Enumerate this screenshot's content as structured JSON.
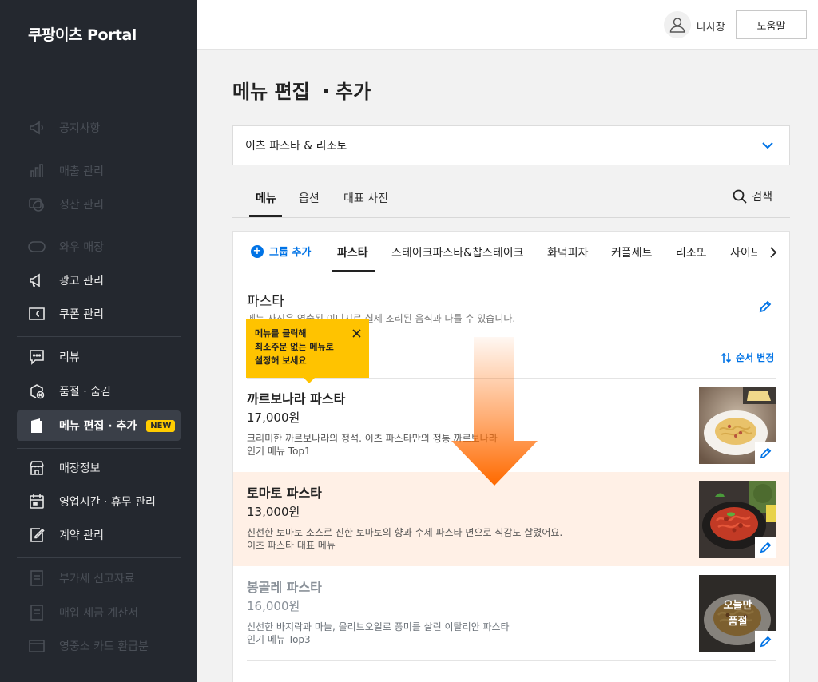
{
  "brand": "쿠팡이츠 Portal",
  "sidebar": {
    "items": [
      {
        "label": "공지사항",
        "icon": "megaphone-icon"
      },
      {
        "label": "매출 관리",
        "icon": "bar-chart-icon"
      },
      {
        "label": "정산 관리",
        "icon": "won-coin-icon"
      },
      {
        "label": "와우 매장",
        "icon": "wow-icon"
      },
      {
        "label": "광고 관리",
        "icon": "megaphone-icon"
      },
      {
        "label": "쿠폰 관리",
        "icon": "coupon-icon"
      },
      {
        "label": "리뷰",
        "icon": "chat-icon"
      },
      {
        "label": "품절 · 숨김",
        "icon": "soldout-box-icon"
      },
      {
        "label": "메뉴 편집 · 추가",
        "icon": "menu-book-icon",
        "badge": "NEW"
      },
      {
        "label": "매장정보",
        "icon": "store-icon"
      },
      {
        "label": "영업시간 · 휴무 관리",
        "icon": "calendar-icon"
      },
      {
        "label": "계약 관리",
        "icon": "contract-icon"
      },
      {
        "label": "부가세 신고자료",
        "icon": "vat-doc-icon"
      },
      {
        "label": "매입 세금 계산서",
        "icon": "tax-doc-icon"
      },
      {
        "label": "영중소 카드 환급분",
        "icon": "card-icon"
      }
    ]
  },
  "header": {
    "username": "나사장",
    "help_label": "도움말"
  },
  "page": {
    "title": "메뉴 편집 ・추가",
    "store_name": "이츠 파스타 & 리조토",
    "tabs": [
      "메뉴",
      "옵션",
      "대표 사진"
    ],
    "search_label": "검색"
  },
  "groups": {
    "add_label": "그룹 추가",
    "tabs": [
      "파스타",
      "스테이크파스타&찹스테이크",
      "화덕피자",
      "커플세트",
      "리조또",
      "사이드"
    ]
  },
  "group": {
    "title": "파스타",
    "description": "메뉴 사진은 연출된 이미지로 실제 조리된 음식과 다를 수 있습니다.",
    "reorder_label": "순서 변경"
  },
  "tooltip": {
    "line1": "메뉴를 클릭해",
    "line2": "최소주문 없는 메뉴로",
    "line3": "설정해 보세요"
  },
  "menu_items": [
    {
      "name": "까르보나라 파스타",
      "price": "17,000원",
      "desc1": "크리미한 까르보나라의 정석. 이츠 파스타만의 정통 까르보나라",
      "desc2": "인기 메뉴 Top1"
    },
    {
      "name": "토마토 파스타",
      "price": "13,000원",
      "desc1": "신선한 토마토 소스로 진한 토마토의 향과 수제 파스타 면으로 식감도 살렸어요.",
      "desc2": "이츠 파스타 대표 메뉴"
    },
    {
      "name": "봉골레 파스타",
      "price": "16,000원",
      "desc1": "신선한 바지락과 마늘, 올리브오일로 풍미를 살린 이탈리안 파스타",
      "desc2": "인기 메뉴 Top3",
      "soldout_line1": "오늘만",
      "soldout_line2": "품절"
    }
  ],
  "colors": {
    "sidebar_bg": "#24282f",
    "accent_blue": "#0073e6",
    "highlight_row": "#fff0e6",
    "tooltip_yellow": "#ffc300",
    "arrow_orange": "#ff6a00",
    "new_badge": "#ffcc00"
  }
}
